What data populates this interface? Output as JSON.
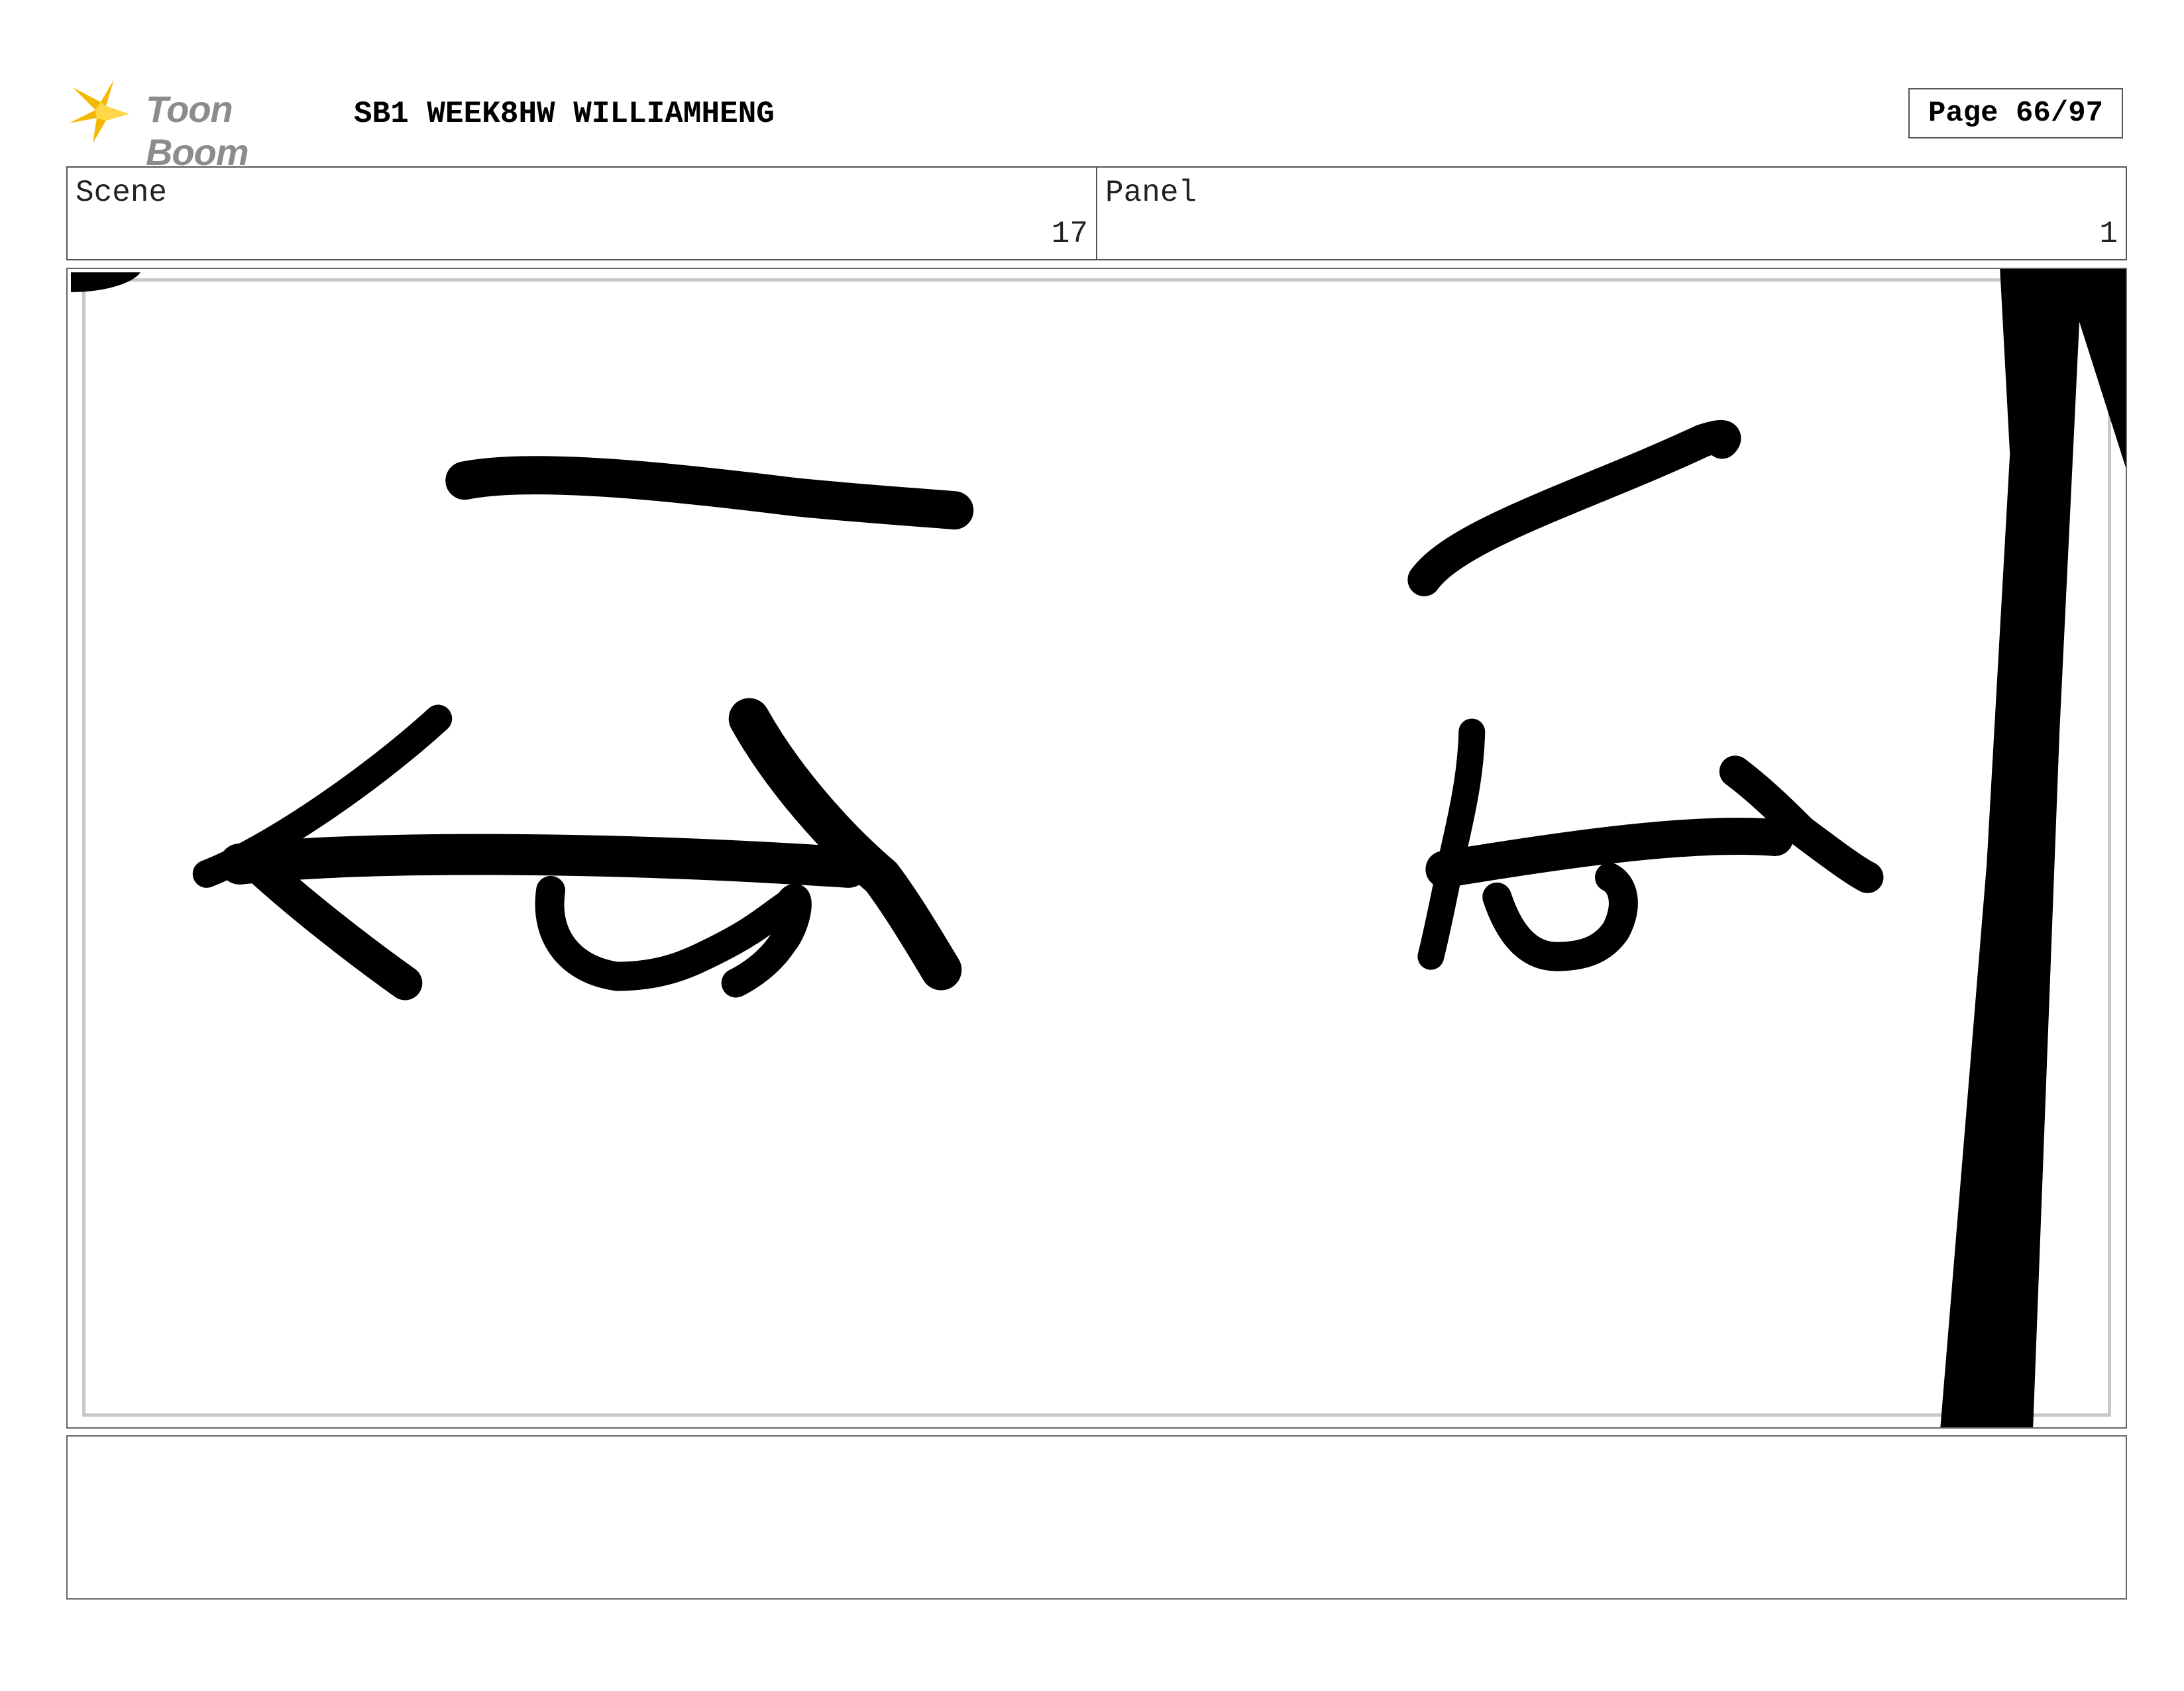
{
  "header": {
    "logo_text": "Toon Boom",
    "title": "SB1 WEEK8HW WILLIAMHENG",
    "page_label": "Page 66/97"
  },
  "info": {
    "scene_label": "Scene",
    "scene_value": "17",
    "panel_label": "Panel",
    "panel_value": "1"
  },
  "colors": {
    "logo_star": "#f5b800",
    "ink": "#000000",
    "frame": "#c8c8c8"
  },
  "icons": {
    "logo": "toon-boom-star-icon"
  },
  "notes": {
    "text": ""
  }
}
